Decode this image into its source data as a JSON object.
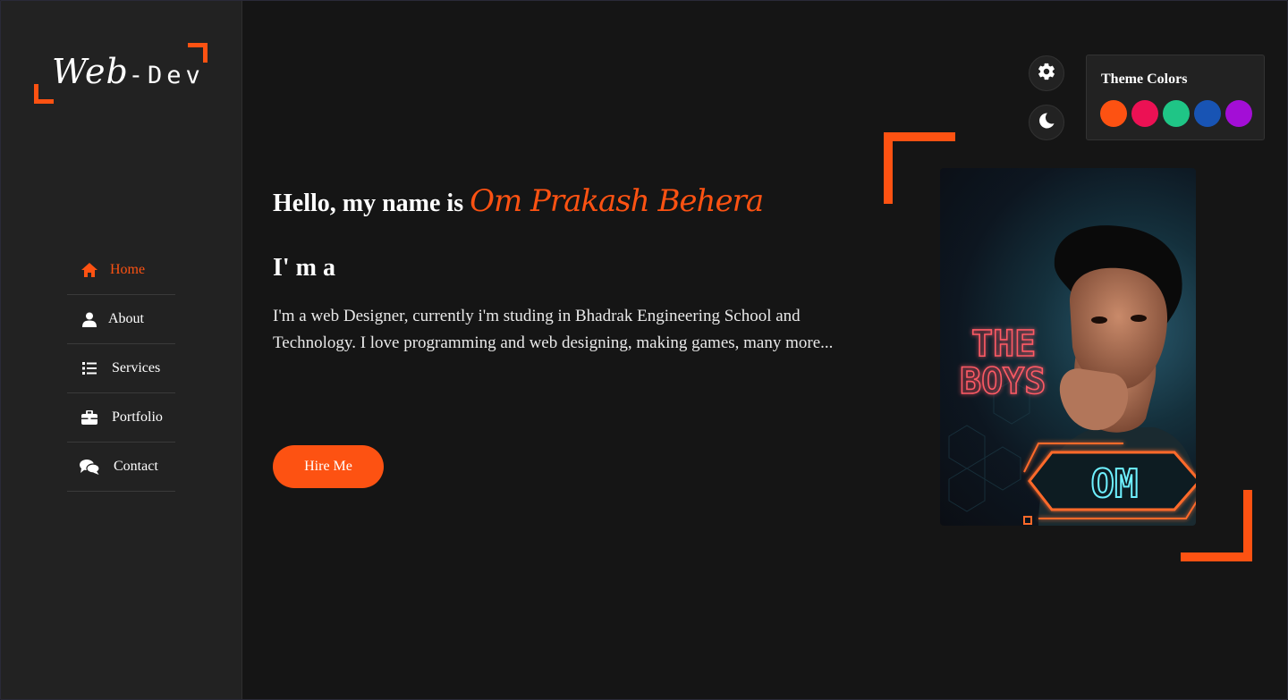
{
  "sidebar": {
    "logo": {
      "script": "Web",
      "sep": "-",
      "word": "Dev"
    },
    "items": [
      {
        "label": "Home",
        "icon": "home-icon",
        "active": true
      },
      {
        "label": "About",
        "icon": "user-icon",
        "active": false
      },
      {
        "label": "Services",
        "icon": "list-icon",
        "active": false
      },
      {
        "label": "Portfolio",
        "icon": "briefcase-icon",
        "active": false
      },
      {
        "label": "Contact",
        "icon": "chat-icon",
        "active": false
      }
    ]
  },
  "main": {
    "greeting_prefix": "Hello, my name is",
    "name": "Om Prakash Behera",
    "role_prefix": "I' m a",
    "intro": "I'm a web Designer, currently i'm studing in Bhadrak Engineering School and Technology. I love programming and web designing, making games, many more...",
    "hire_label": "Hire Me"
  },
  "style_switcher": {
    "settings_icon": "gear-icon",
    "mode_icon": "moon-icon",
    "panel_title": "Theme Colors",
    "swatches": [
      "#fd5212",
      "#ec1154",
      "#1fc586",
      "#1854b4",
      "#a30ed6"
    ]
  },
  "photo": {
    "neon_text_top": "THE",
    "neon_text_bottom": "BOYS",
    "badge_text": "OM"
  },
  "colors": {
    "accent": "#fd5212",
    "background": "#151515",
    "sidebar": "#222222"
  }
}
